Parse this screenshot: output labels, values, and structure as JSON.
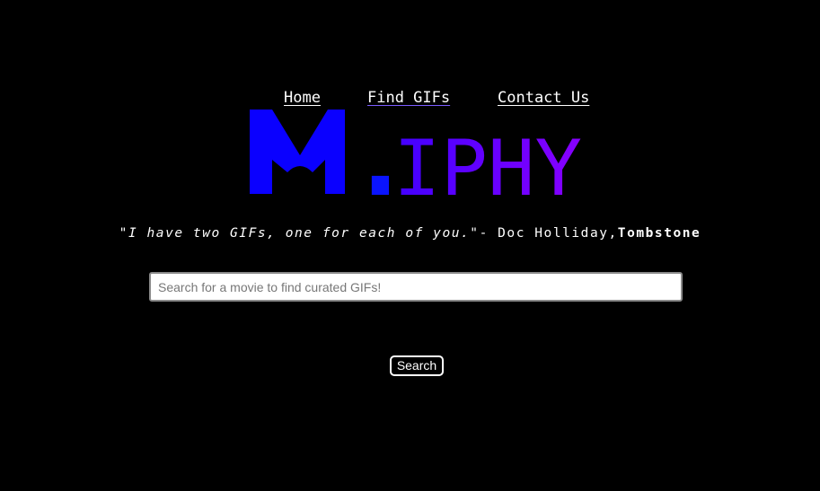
{
  "nav": {
    "items": [
      {
        "label": "Home"
      },
      {
        "label": "Find GIFs"
      },
      {
        "label": "Contact Us"
      }
    ]
  },
  "logo": {
    "letter_m": "M",
    "dot": ".",
    "rest": "IPHY",
    "colors": {
      "blue": "#0a00ff",
      "purple": "#8b00ff"
    }
  },
  "quote": {
    "text": "\"I have two GIFs, one for each of you.\"",
    "attribution": "- Doc Holliday,",
    "movie": "Tombstone"
  },
  "search": {
    "value": "",
    "placeholder": "Search for a movie to find curated GIFs!",
    "button_label": "Search"
  }
}
